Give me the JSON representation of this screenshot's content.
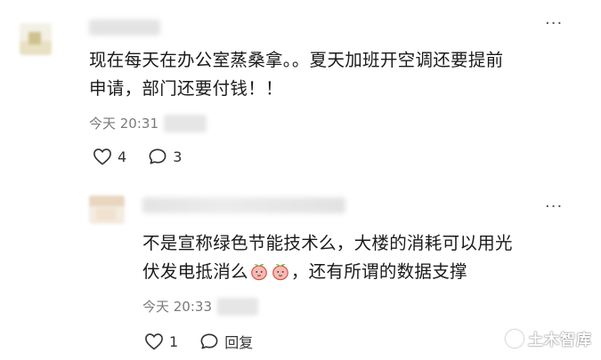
{
  "comments": [
    {
      "text_line1": "现在每天在办公室蒸桑拿。。夏天加班开空调还要提前",
      "text_line2": "申请，部门还要付钱！！",
      "time": "今天 20:31",
      "likes": "4",
      "replies": "3",
      "more_glyph": "···"
    },
    {
      "text_line1": "不是宣称绿色节能技术么，大楼的消耗可以用光",
      "text_line2_a": "伏发电抵消么",
      "text_line2_b": "，还有所谓的数据支撑",
      "time": "今天 20:33",
      "likes": "1",
      "reply_label": "回复",
      "more_glyph": "···"
    }
  ],
  "watermark": "土木智库",
  "colors": {
    "text": "#1a1a1a",
    "meta": "#7a7a7a",
    "icon": "#333333"
  }
}
